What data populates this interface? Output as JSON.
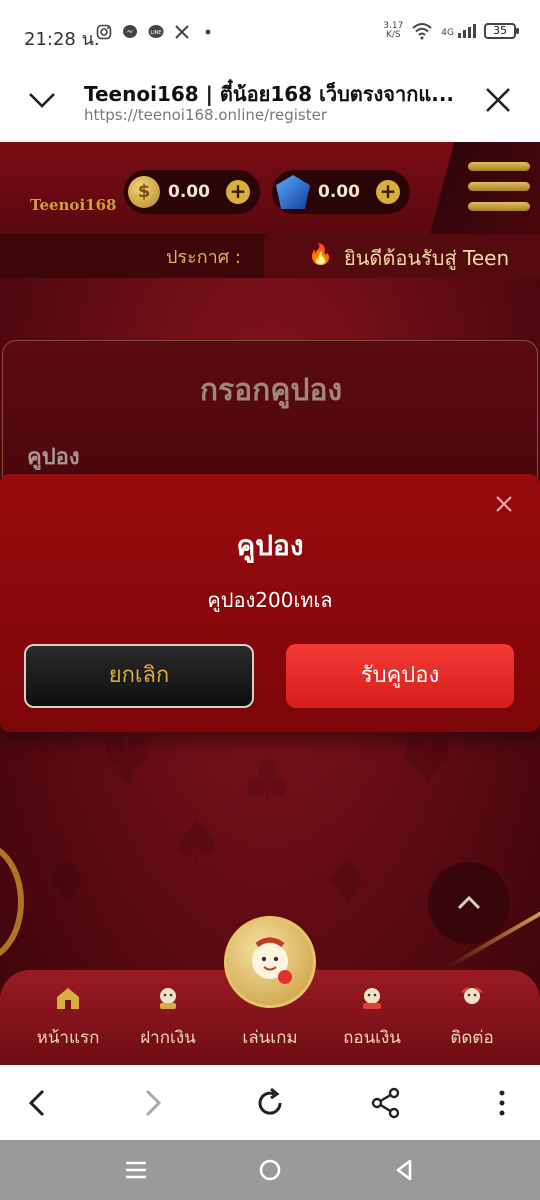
{
  "status_bar": {
    "time": "21:28 น.",
    "speed_value": "3.17",
    "speed_unit": "K/S",
    "network": "4G",
    "battery": "35"
  },
  "browser_header": {
    "title": "Teenoi168 | ตี๋น้อย168 เว็บตรงจากแ...",
    "url": "https://teenoi168.online/register"
  },
  "site_header": {
    "logo_text": "Teenoi168",
    "wallet_coin": "0.00",
    "wallet_gem": "0.00",
    "announce_label": "ประกาศ :",
    "announce_text": "ยินดีต้อนรับสู่ Teen"
  },
  "coupon_card": {
    "title": "กรอกคูปอง",
    "field_label": "คูปอง"
  },
  "modal": {
    "title": "คูปอง",
    "message": "คูปอง200เทเล",
    "cancel_label": "ยกเลิก",
    "accept_label": "รับคูปอง"
  },
  "bottom_nav": {
    "items": [
      {
        "label": "หน้าแรก",
        "icon": "home-icon"
      },
      {
        "label": "ฝากเงิน",
        "icon": "deposit-icon"
      },
      {
        "label": "เล่นเกม",
        "icon": "play-icon"
      },
      {
        "label": "ถอนเงิน",
        "icon": "withdraw-icon"
      },
      {
        "label": "ติดต่อ",
        "icon": "contact-icon"
      }
    ]
  },
  "colors": {
    "accent_red": "#f43a35",
    "gold": "#d8ae3e",
    "background_red": "#7c0608"
  }
}
